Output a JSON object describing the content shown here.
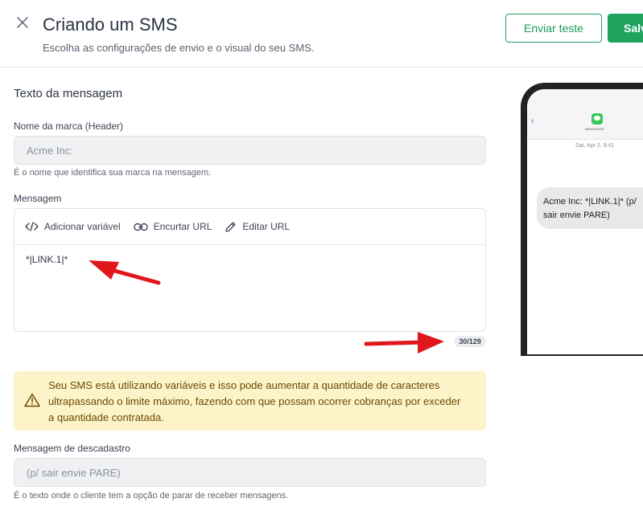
{
  "header": {
    "title": "Criando um SMS",
    "subtitle": "Escolha as configurações de envio e o visual do seu SMS.",
    "test_button": "Enviar teste",
    "save_button": "Salvar"
  },
  "form": {
    "section_title": "Texto da mensagem",
    "brand": {
      "label": "Nome da marca (Header)",
      "placeholder": "Acme Inc:",
      "helper": "É o nome que identifica sua marca na mensagem."
    },
    "message": {
      "label": "Mensagem",
      "toolbar": {
        "add_variable": "Adicionar variável",
        "shorten_url": "Encurtar URL",
        "edit_url": "Editar URL"
      },
      "body": "*|LINK.1|*",
      "counter": "30/129"
    },
    "alert": {
      "text": "Seu SMS está utilizando variáveis e isso pode aumentar a quantidade de caracteres ultrapassando o limite máximo, fazendo com que possam ocorrer cobranças por exceder a quantidade contratada."
    },
    "unsubscribe": {
      "label": "Mensagem de descadastro",
      "placeholder": "(p/ sair envie PARE)",
      "helper": "É o texto onde o cliente tem a opção de parar de receber mensagens."
    }
  },
  "preview": {
    "back_symbol": "‹",
    "contact_name": "MENSAGEM",
    "timestamp": "Sat, Apr 2, 9:41",
    "bubble_text": "Acme Inc: *|LINK.1|* (p/ sair envie PARE)"
  },
  "colors": {
    "primary": "#1ea45f",
    "alert_bg": "#fdf3c9",
    "alert_text": "#6b4a00",
    "annotation": "#e0171b"
  }
}
